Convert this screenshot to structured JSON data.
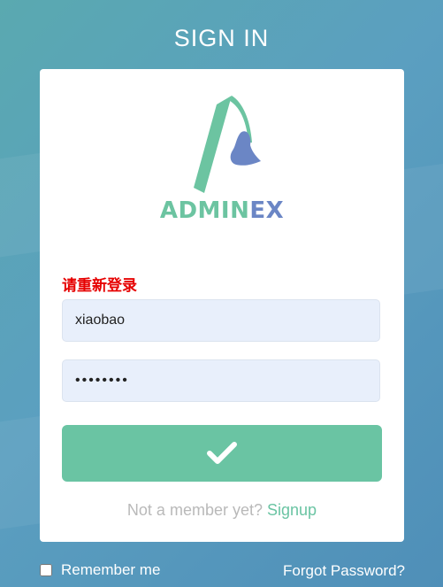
{
  "page": {
    "title": "SIGN IN"
  },
  "logo": {
    "text_part1": "ADMIN",
    "text_part2": "EX",
    "brand_color": "#6cc4a1",
    "accent_color": "#6b86c5"
  },
  "form": {
    "error_message": "请重新登录",
    "username_value": "xiaobao",
    "password_value": "••••••••",
    "submit_icon": "check-icon"
  },
  "signup": {
    "prompt": "Not a member yet?",
    "link_label": "Signup"
  },
  "footer": {
    "remember_label": "Remember me",
    "forgot_label": "Forgot Password?"
  },
  "colors": {
    "primary_button": "#6ac4a3",
    "error": "#e60000",
    "input_bg": "#e8effb"
  }
}
